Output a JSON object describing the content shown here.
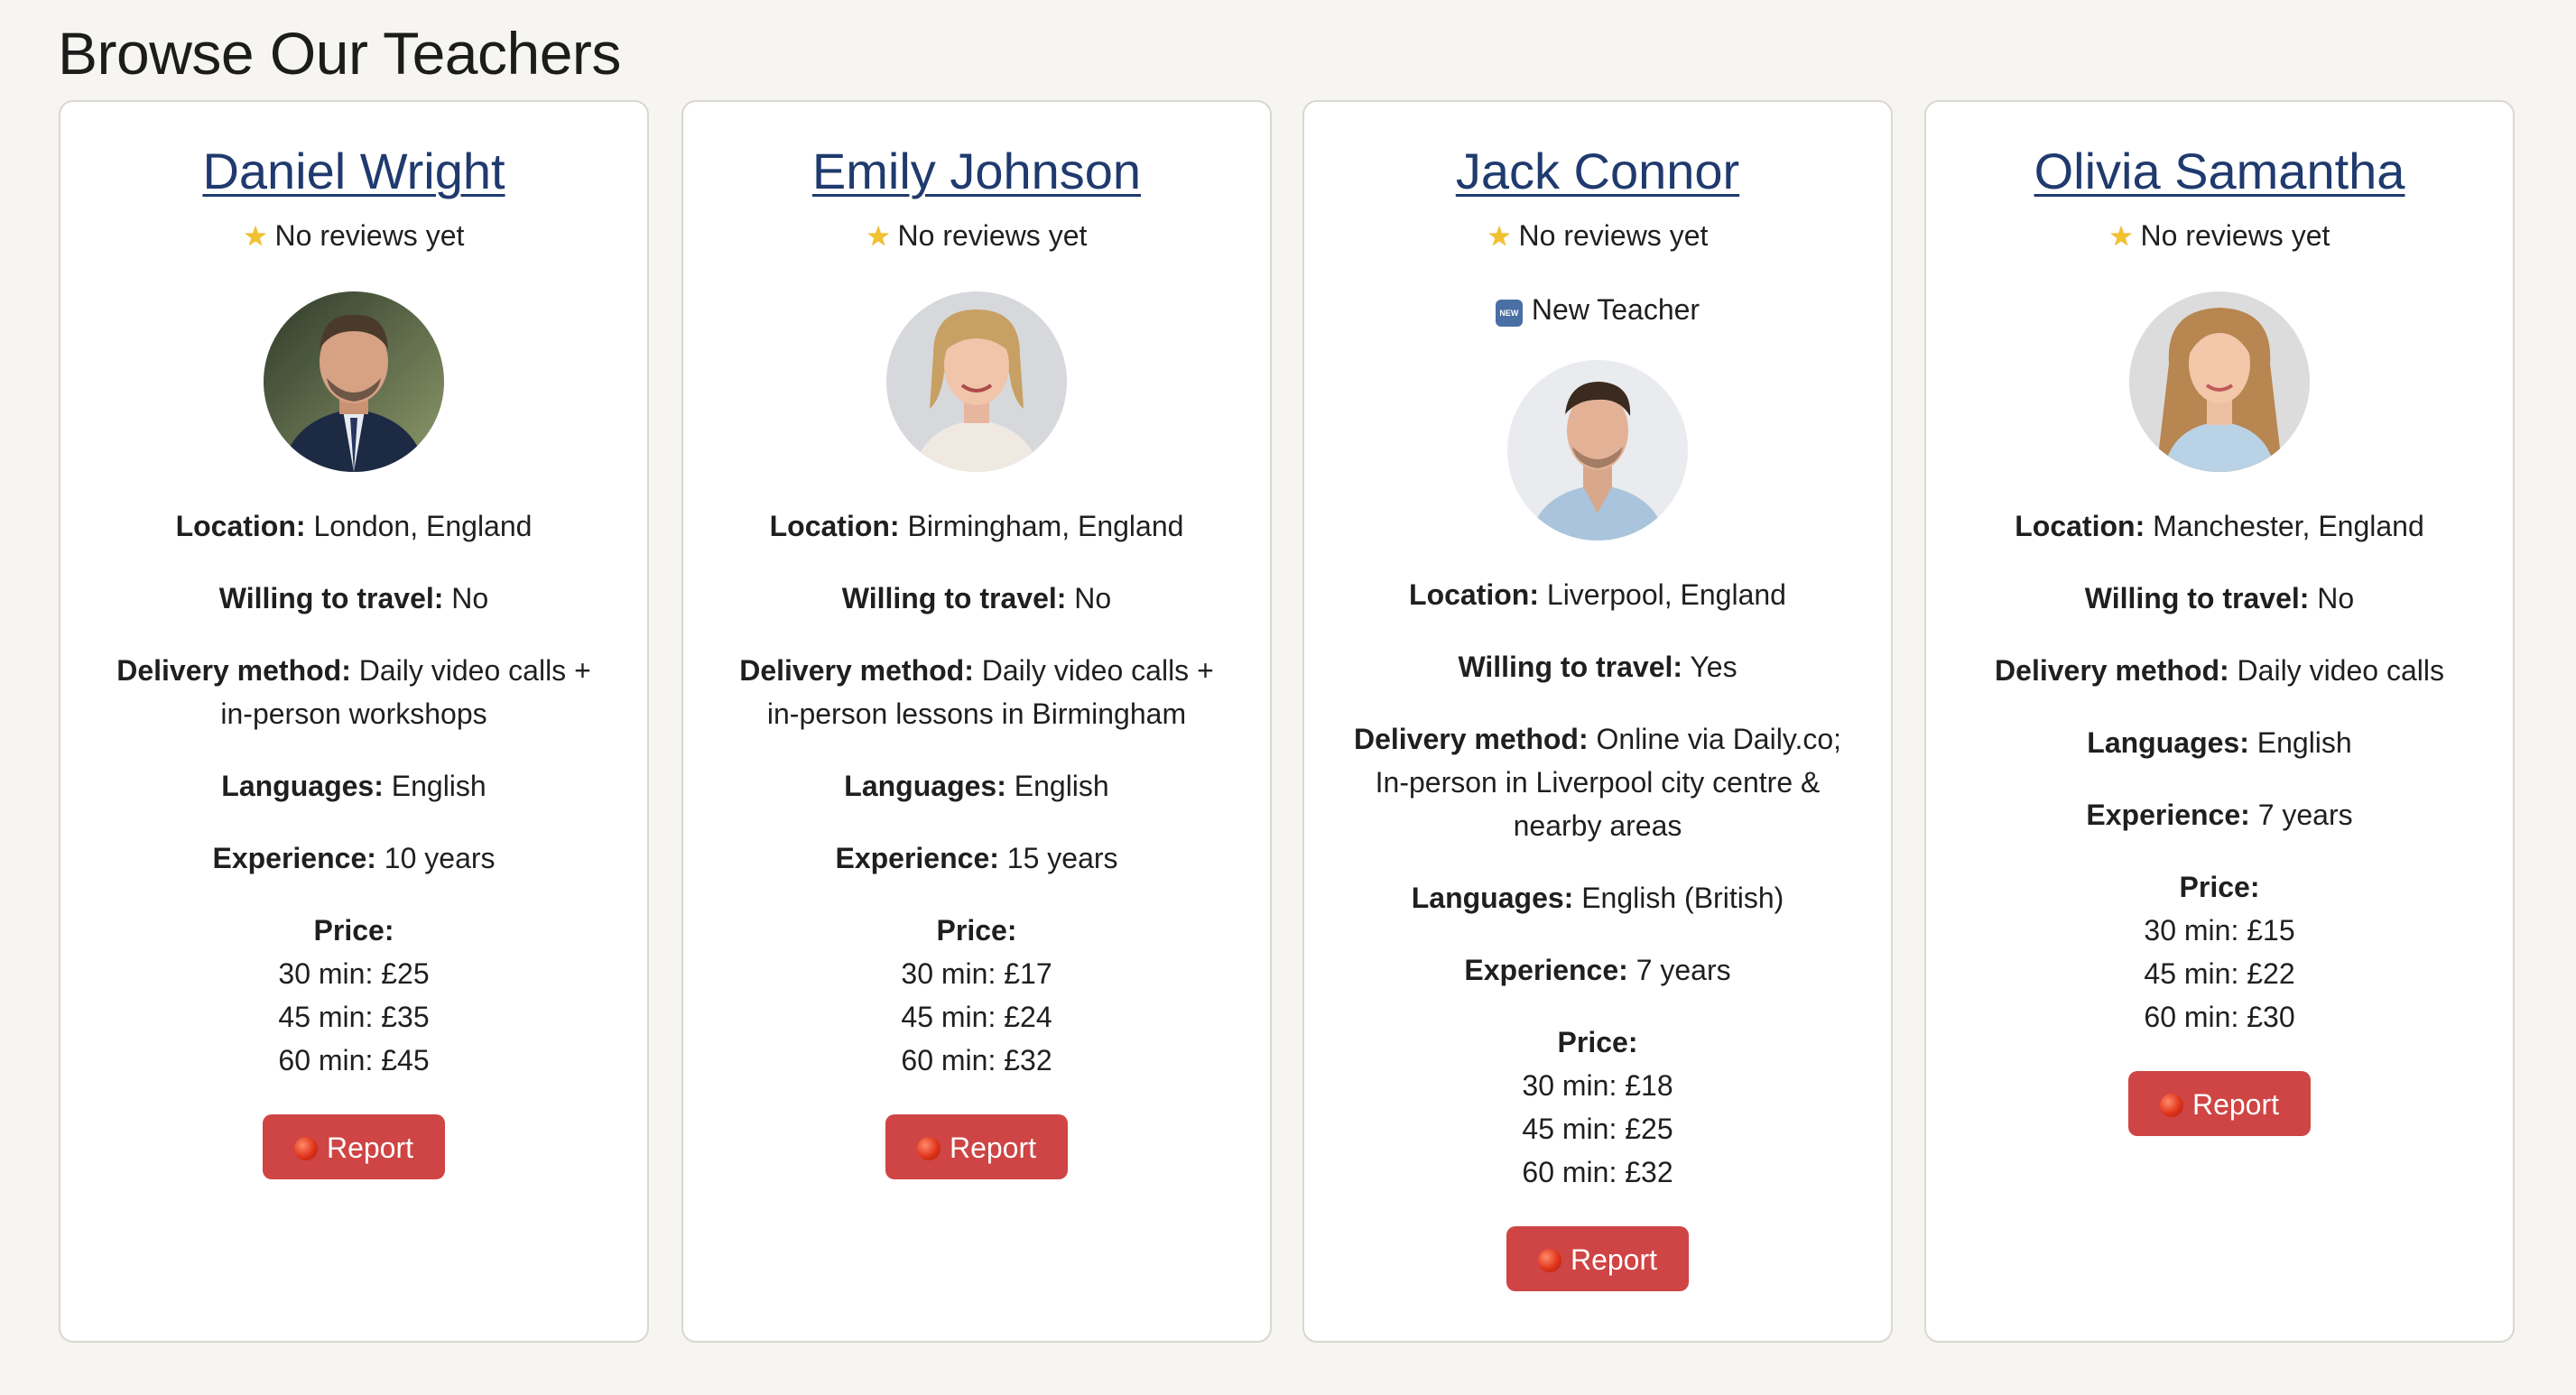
{
  "header": {
    "title": "Browse Our Teachers"
  },
  "colors": {
    "link": "#1f3a6e",
    "report_button": "#cf4444",
    "page_bg": "#f6f5f1"
  },
  "labels": {
    "location": "Location:",
    "travel": "Willing to travel:",
    "delivery": "Delivery method:",
    "languages": "Languages:",
    "experience": "Experience:",
    "price": "Price:"
  },
  "teachers": [
    {
      "name": "Daniel Wright",
      "reviews": "No reviews yet",
      "badge": "",
      "location": "London, England",
      "travel": "No",
      "delivery_line1": "Daily video calls +",
      "delivery_line2": "in-person workshops",
      "languages": "English",
      "experience": "10 years",
      "price_30": "30 min: £25",
      "price_45": "45 min: £35",
      "price_60": "60 min: £45",
      "report_label": "Report",
      "avatar_icon": "person-avatar-icon"
    },
    {
      "name": "Emily Johnson",
      "reviews": "No reviews yet",
      "badge": "",
      "location": "Birmingham, England",
      "travel": "No",
      "delivery_line1": "Daily video calls +",
      "delivery_line2": "in-person lessons in Birmingham",
      "languages": "English",
      "experience": "15 years",
      "price_30": "30 min: £17",
      "price_45": "45 min: £24",
      "price_60": "60 min: £32",
      "report_label": "Report",
      "avatar_icon": "person-avatar-icon"
    },
    {
      "name": "Jack Connor",
      "reviews": "No reviews yet",
      "badge": "New Teacher",
      "badge_icon_text": "NEW",
      "location": "Liverpool, England",
      "travel": "Yes",
      "delivery_line1": "Online via Daily.co;",
      "delivery_line2": "In-person in Liverpool city centre &",
      "delivery_line3": "nearby areas",
      "languages": "English (British)",
      "experience": "7 years",
      "price_30": "30 min: £18",
      "price_45": "45 min: £25",
      "price_60": "60 min: £32",
      "report_label": "Report",
      "avatar_icon": "person-avatar-icon"
    },
    {
      "name": "Olivia Samantha",
      "reviews": "No reviews yet",
      "badge": "",
      "location": "Manchester, England",
      "travel": "No",
      "delivery_line1": "Daily video calls",
      "languages": "English",
      "experience": "7 years",
      "price_30": "30 min: £15",
      "price_45": "45 min: £22",
      "price_60": "60 min: £30",
      "report_label": "Report",
      "avatar_icon": "person-avatar-icon"
    }
  ]
}
